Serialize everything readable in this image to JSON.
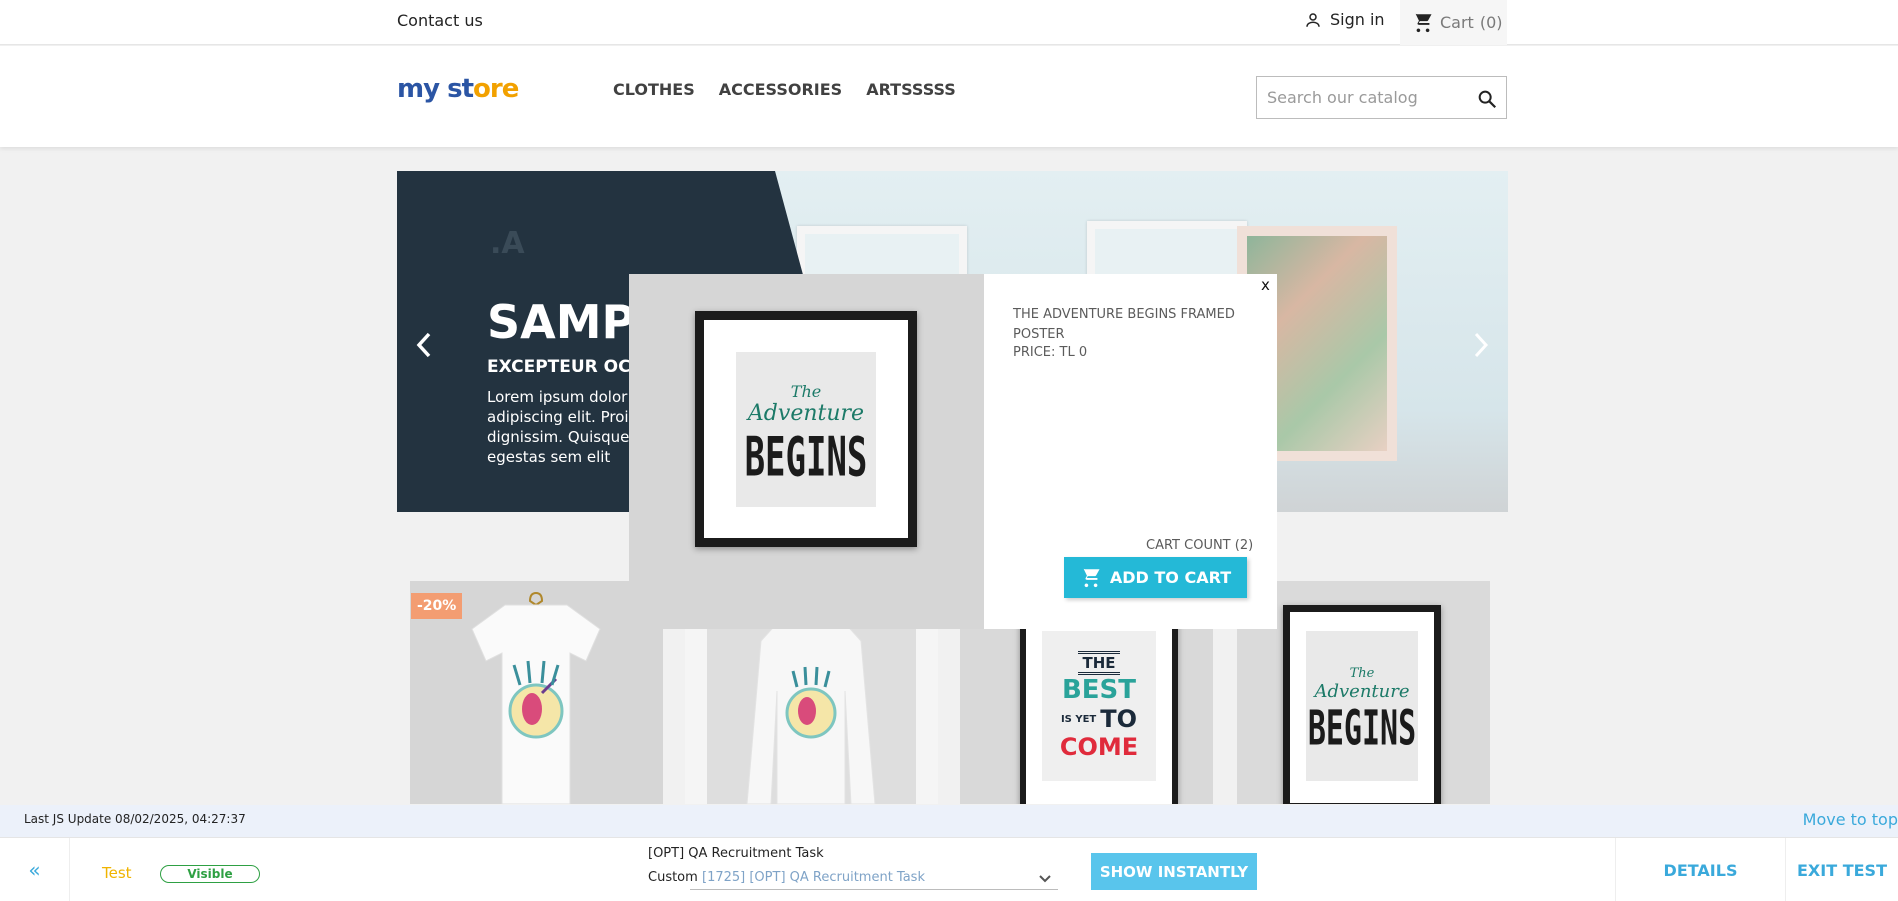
{
  "topbar": {
    "contact": "Contact us",
    "signin": "Sign in",
    "cart": "Cart",
    "cart_count": "(0)"
  },
  "header": {
    "logo": [
      "my",
      " ",
      "st",
      "ore"
    ],
    "nav": [
      "CLOTHES",
      "ACCESSORIES",
      "ARTSSSSS"
    ],
    "search_placeholder": "Search our catalog"
  },
  "banner": {
    "title": "SAMP",
    "subtitle": "EXCEPTEUR OCC",
    "text": [
      "Lorem ipsum dolor s",
      "adipiscing elit. Proin",
      "dignissim. Quisque n",
      "egestas sem elit"
    ],
    "mark": ".A"
  },
  "products": {
    "discount": "-20%"
  },
  "modal": {
    "close": "x",
    "product_title": "THE ADVENTURE BEGINS FRAMED POSTER",
    "price": "PRICE: TL 0",
    "cart_count": "CART COUNT (2)",
    "add_to_cart": "ADD TO CART"
  },
  "poster_adventure": {
    "line1": "The",
    "line2": "Adventure",
    "line3": "BEGINS"
  },
  "poster_best": {
    "line1": "THE",
    "line2": "BEST",
    "line3": "IS YET",
    "line4": "TO",
    "line5": "COME"
  },
  "test_bar": {
    "js_update": "Last JS Update 08/02/2025, 04:27:37",
    "move_top": "Move to top",
    "collapse": "«",
    "test_label": "Test",
    "visible": "Visible",
    "task_name": "[OPT] QA Recruitment Task",
    "custom_label": "Custom",
    "task_select": "[1725] [OPT] QA Recruitment Task",
    "show_instantly": "SHOW INSTANTLY",
    "details": "DETAILS",
    "exit_test": "EXIT TEST"
  },
  "colors": {
    "accent": "#24b9d7",
    "banner_dark": "#233340",
    "discount": "#f39d72",
    "test_blue": "#3aa9db",
    "test_yellow": "#f0b400",
    "visible_green": "#2ea043"
  }
}
